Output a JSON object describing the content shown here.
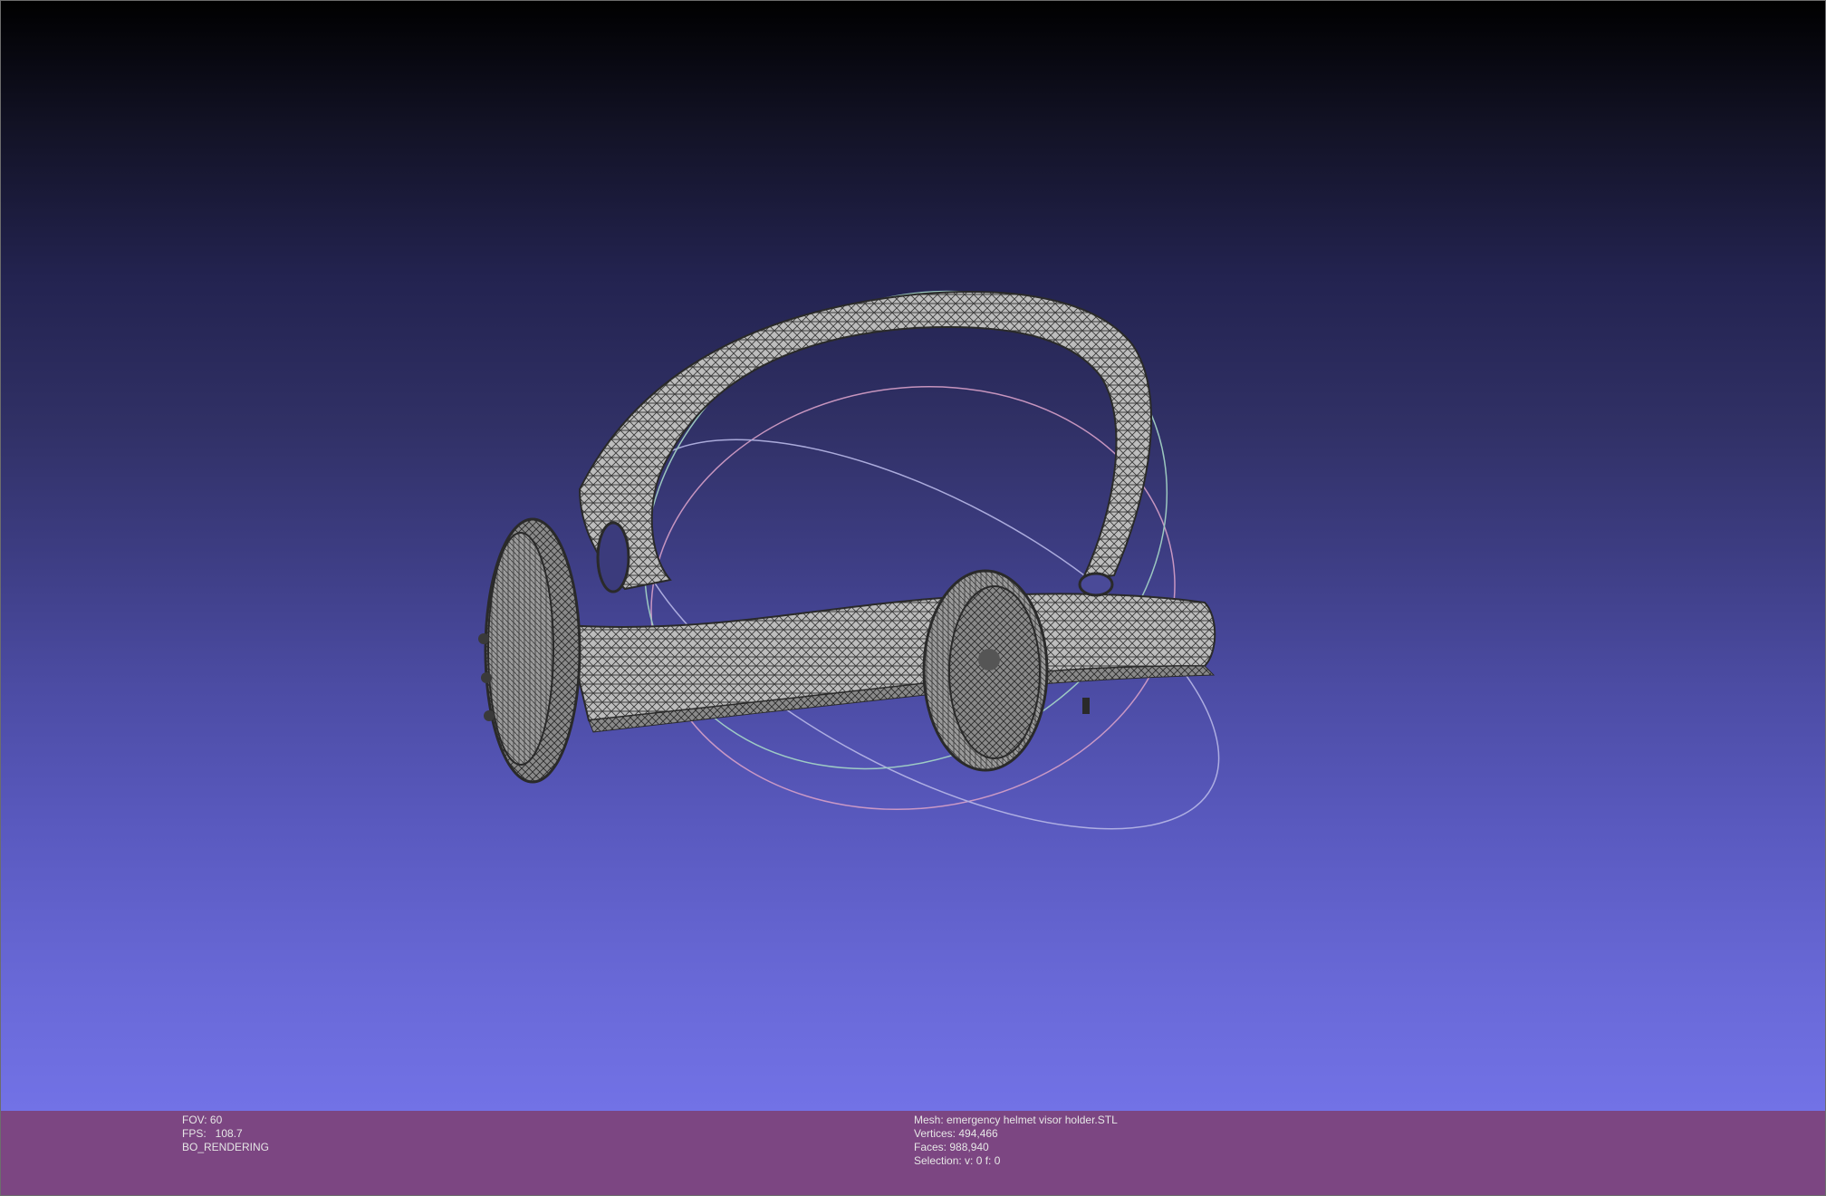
{
  "viewer": {
    "colors": {
      "background_top": "#000000",
      "background_bottom": "#7272e6",
      "info_bar": "#7c4682",
      "info_text": "#e6e6e6",
      "mesh_fill": "#b9b9b9",
      "mesh_wire": "#3a3a3a"
    },
    "trackball_icon": "trackball-icon",
    "mesh_icon": "wireframe-mesh-icon"
  },
  "status": {
    "fov": "FOV: 60",
    "fps": "FPS:   108.7",
    "mode": "BO_RENDERING"
  },
  "mesh_info": {
    "mesh": "Mesh: emergency helmet visor holder.STL",
    "vertices": "Vertices: 494,466",
    "faces": "Faces: 988,940",
    "selection": "Selection: v: 0 f: 0"
  }
}
